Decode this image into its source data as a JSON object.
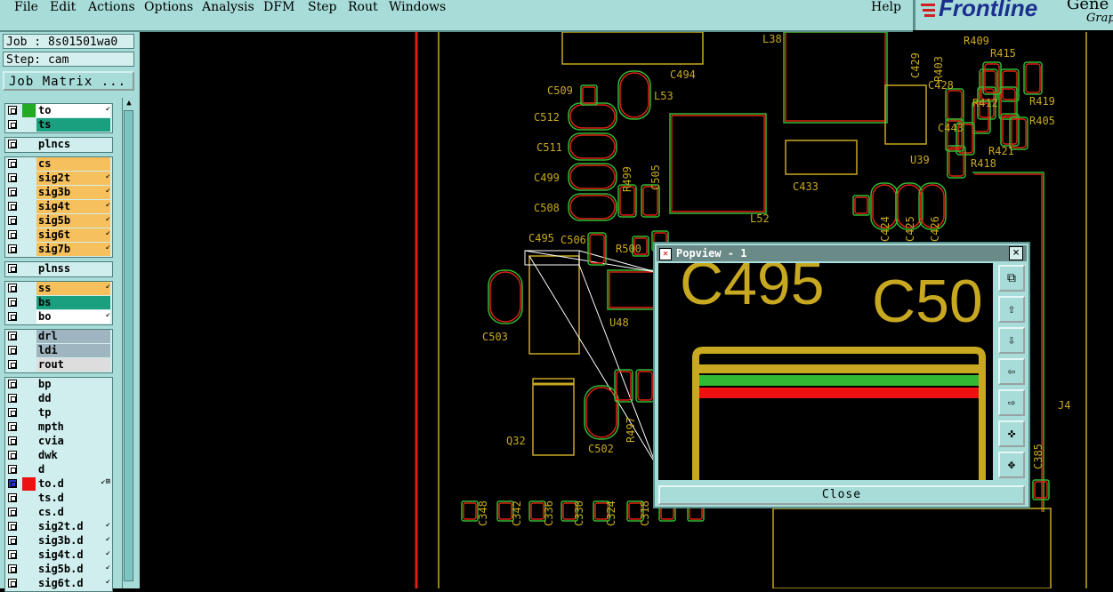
{
  "menu": [
    "File",
    "Edit",
    "Actions",
    "Options",
    "Analysis",
    "DFM",
    "Step",
    "Rout",
    "Windows"
  ],
  "help": "Help",
  "logo": {
    "brand": "Frontline",
    "text1": "Gene",
    "text2": "Grap"
  },
  "job_label": "Job : 8s01501wa0",
  "step_label": "Step: cam",
  "job_matrix_button": "Job Matrix ...",
  "layers": [
    {
      "name": "to",
      "color": "#ffffff",
      "swatch": "#22aa22",
      "arrow": "↙"
    },
    {
      "name": "ts",
      "color": "#1aa07e",
      "swatch": "",
      "arrow": ""
    },
    {
      "name": "plncs",
      "color": "#cfeeed",
      "swatch": "",
      "arrow": ""
    },
    {
      "name": "cs",
      "color": "#f6c15d",
      "swatch": "",
      "arrow": ""
    },
    {
      "name": "sig2t",
      "color": "#f6c15d",
      "swatch": "",
      "arrow": "↙"
    },
    {
      "name": "sig3b",
      "color": "#f6c15d",
      "swatch": "",
      "arrow": "↙"
    },
    {
      "name": "sig4t",
      "color": "#f6c15d",
      "swatch": "",
      "arrow": "↙"
    },
    {
      "name": "sig5b",
      "color": "#f6c15d",
      "swatch": "",
      "arrow": "↙"
    },
    {
      "name": "sig6t",
      "color": "#f6c15d",
      "swatch": "",
      "arrow": "↙"
    },
    {
      "name": "sig7b",
      "color": "#f6c15d",
      "swatch": "",
      "arrow": "↙"
    },
    {
      "name": "plnss",
      "color": "#cfeeed",
      "swatch": "",
      "arrow": ""
    },
    {
      "name": "ss",
      "color": "#f6c15d",
      "swatch": "",
      "arrow": "↙"
    },
    {
      "name": "bs",
      "color": "#1aa07e",
      "swatch": "",
      "arrow": ""
    },
    {
      "name": "bo",
      "color": "#ffffff",
      "swatch": "",
      "arrow": "↙"
    },
    {
      "name": "drl",
      "color": "#9fb6c0",
      "swatch": "",
      "arrow": ""
    },
    {
      "name": "ldi",
      "color": "#9fb6c0",
      "swatch": "",
      "arrow": ""
    },
    {
      "name": "rout",
      "color": "#dddddd",
      "swatch": "",
      "arrow": ""
    },
    {
      "name": "bp",
      "color": "#cfeeed",
      "swatch": "",
      "arrow": ""
    },
    {
      "name": "dd",
      "color": "#cfeeed",
      "swatch": "",
      "arrow": ""
    },
    {
      "name": "tp",
      "color": "#cfeeed",
      "swatch": "",
      "arrow": ""
    },
    {
      "name": "mpth",
      "color": "#cfeeed",
      "swatch": "",
      "arrow": ""
    },
    {
      "name": "cvia",
      "color": "#cfeeed",
      "swatch": "",
      "arrow": ""
    },
    {
      "name": "dwk",
      "color": "#cfeeed",
      "swatch": "",
      "arrow": ""
    },
    {
      "name": "d",
      "color": "#cfeeed",
      "swatch": "",
      "arrow": ""
    },
    {
      "name": "to.d",
      "color": "#cfeeed",
      "swatch": "#ee1111",
      "arrow": "↙⊞"
    },
    {
      "name": "ts.d",
      "color": "#cfeeed",
      "swatch": "",
      "arrow": ""
    },
    {
      "name": "cs.d",
      "color": "#cfeeed",
      "swatch": "",
      "arrow": ""
    },
    {
      "name": "sig2t.d",
      "color": "#cfeeed",
      "swatch": "",
      "arrow": "↙"
    },
    {
      "name": "sig3b.d",
      "color": "#cfeeed",
      "swatch": "",
      "arrow": "↙"
    },
    {
      "name": "sig4t.d",
      "color": "#cfeeed",
      "swatch": "",
      "arrow": "↙"
    },
    {
      "name": "sig5b.d",
      "color": "#cfeeed",
      "swatch": "",
      "arrow": "↙"
    },
    {
      "name": "sig6t.d",
      "color": "#cfeeed",
      "swatch": "",
      "arrow": "↙"
    }
  ],
  "canvas_labels": [
    "L38",
    "C494",
    "C509",
    "L53",
    "C512",
    "C511",
    "C499",
    "C508",
    "R499",
    "C505",
    "C433",
    "L52",
    "R409",
    "R415",
    "R412",
    "R419",
    "R405",
    "R403",
    "C429",
    "C428",
    "C443",
    "R421",
    "R418",
    "U39",
    "C424",
    "C425",
    "C426",
    "C495",
    "C506",
    "R500",
    "C503",
    "U48",
    "C502",
    "R497",
    "Q32",
    "J4",
    "C385",
    "C348",
    "C342",
    "C336",
    "C330",
    "C324",
    "C318"
  ],
  "popview": {
    "title": "Popview - 1",
    "zoom_text_1": "C495",
    "zoom_text_2": "C50",
    "close_label": "Close",
    "tools": [
      "zoom-fit-icon",
      "pan-up-icon",
      "pan-down-icon",
      "pan-left-icon",
      "pan-right-icon",
      "zoom-in-icon",
      "zoom-out-icon"
    ]
  },
  "colors": {
    "panel": "#a7dcd9",
    "trace": "#c8a820",
    "green": "#33b833",
    "red": "#ee1111"
  }
}
